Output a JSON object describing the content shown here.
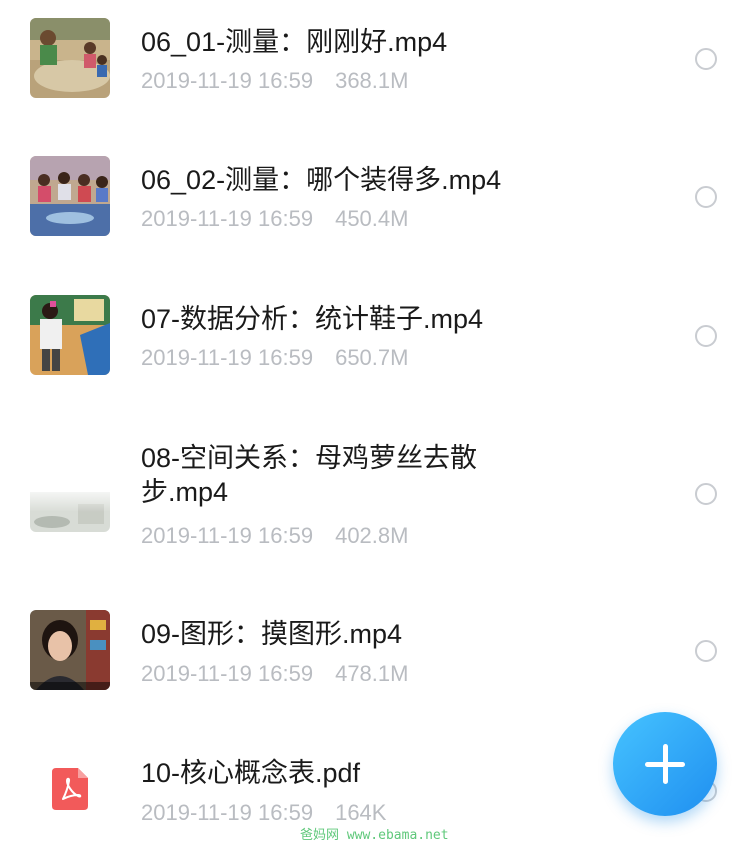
{
  "files": [
    {
      "name": "06_01-测量：刚刚好.mp4",
      "date": "2019-11-19 16:59",
      "size": "368.1M",
      "type": "video",
      "thumb_icon": "video-thumbnail-icon"
    },
    {
      "name": "06_02-测量：哪个装得多.mp4",
      "date": "2019-11-19 16:59",
      "size": "450.4M",
      "type": "video",
      "thumb_icon": "video-thumbnail-icon"
    },
    {
      "name": "07-数据分析：统计鞋子.mp4",
      "date": "2019-11-19 16:59",
      "size": "650.7M",
      "type": "video",
      "thumb_icon": "video-thumbnail-icon"
    },
    {
      "name": "08-空间关系：母鸡萝丝去散步.mp4",
      "date": "2019-11-19 16:59",
      "size": "402.8M",
      "type": "video",
      "thumb_icon": "video-thumbnail-icon"
    },
    {
      "name": "09-图形：摸图形.mp4",
      "date": "2019-11-19 16:59",
      "size": "478.1M",
      "type": "video",
      "thumb_icon": "video-thumbnail-icon"
    },
    {
      "name": "10-核心概念表.pdf",
      "date": "2019-11-19 16:59",
      "size": "164K",
      "type": "pdf",
      "thumb_icon": "pdf-file-icon"
    }
  ],
  "fab": {
    "icon": "plus-icon",
    "color": "#2a9df4"
  },
  "watermark": "爸妈网 www.ebama.net",
  "colors": {
    "name_text": "#1a1a1a",
    "meta_text": "#b9bcc1",
    "radio_border": "#c9ccd1",
    "pdf_icon": "#f25a5a"
  }
}
